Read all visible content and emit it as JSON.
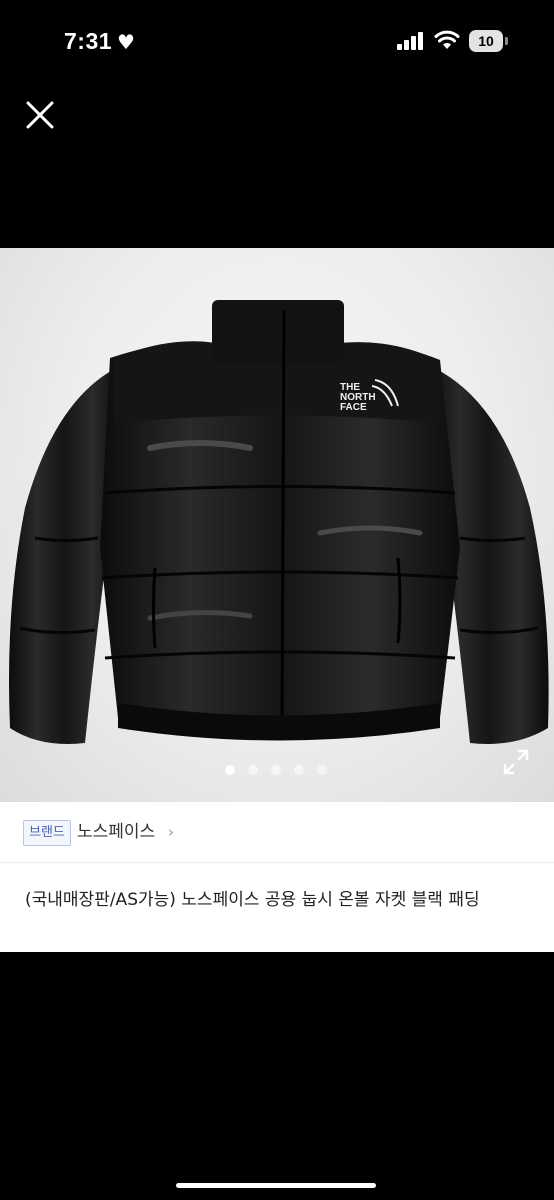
{
  "status_bar": {
    "time": "7:31",
    "heart": "♥",
    "battery": "10"
  },
  "close_icon": "close-icon",
  "product": {
    "image_logo_text": [
      "THE",
      "NORTH",
      "FACE"
    ],
    "carousel": {
      "count": 5,
      "active_index": 0
    },
    "brand_badge": "브랜드",
    "brand_name": "노스페이스",
    "brand_chevron": "›",
    "title": "(국내매장판/AS가능) 노스페이스 공용 눕시 온볼 자켓 블랙 패딩"
  },
  "colors": {
    "background": "#000000",
    "info_background": "#ffffff",
    "badge_text": "#4a63b4",
    "badge_border": "#b9c3e4"
  }
}
